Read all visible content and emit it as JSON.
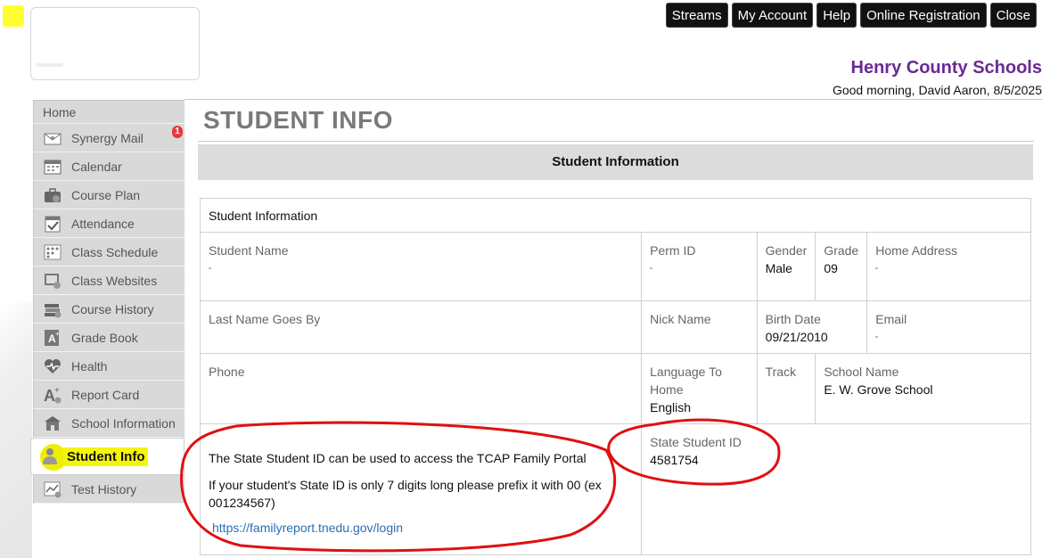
{
  "header": {
    "buttons": [
      "Streams",
      "My Account",
      "Help",
      "Online Registration",
      "Close"
    ],
    "district": "Henry County Schools",
    "greeting": "Good morning, David Aaron, 8/5/2025"
  },
  "sidebar": {
    "items": [
      {
        "label": "Home",
        "icon": "home"
      },
      {
        "label": "Synergy Mail",
        "icon": "mail-icon",
        "badge": "1"
      },
      {
        "label": "Calendar",
        "icon": "calendar-icon"
      },
      {
        "label": "Course Plan",
        "icon": "briefcase-icon"
      },
      {
        "label": "Attendance",
        "icon": "attendance-icon"
      },
      {
        "label": "Class Schedule",
        "icon": "schedule-icon"
      },
      {
        "label": "Class Websites",
        "icon": "websites-icon"
      },
      {
        "label": "Course History",
        "icon": "books-icon"
      },
      {
        "label": "Grade Book",
        "icon": "gradebook-icon"
      },
      {
        "label": "Health",
        "icon": "heart-icon"
      },
      {
        "label": "Report Card",
        "icon": "report-card-icon"
      },
      {
        "label": "School Information",
        "icon": "school-icon"
      },
      {
        "label": "Student Info",
        "icon": "student-icon"
      },
      {
        "label": "Test History",
        "icon": "test-history-icon"
      }
    ]
  },
  "main": {
    "title": "STUDENT INFO",
    "section_header": "Student Information",
    "table_caption": "Student Information",
    "fields": {
      "student_name": {
        "label": "Student Name",
        "value": ""
      },
      "perm_id": {
        "label": "Perm ID",
        "value": ""
      },
      "gender": {
        "label": "Gender",
        "value": "Male"
      },
      "grade": {
        "label": "Grade",
        "value": "09"
      },
      "home_address": {
        "label": "Home Address",
        "value": ""
      },
      "last_name_goes_by": {
        "label": "Last Name Goes By",
        "value": ""
      },
      "nick_name": {
        "label": "Nick Name",
        "value": ""
      },
      "birth_date": {
        "label": "Birth Date",
        "value": "09/21/2010"
      },
      "email": {
        "label": "Email",
        "value": ""
      },
      "phone": {
        "label": "Phone",
        "value": ""
      },
      "language": {
        "label": "Language To Home",
        "value": "English"
      },
      "track": {
        "label": "Track",
        "value": ""
      },
      "school_name": {
        "label": "School Name",
        "value": "E. W. Grove School"
      },
      "state_student_id": {
        "label": "State Student ID",
        "value": "4581754"
      }
    },
    "tcap": {
      "line1": "The State Student ID can be used to access the TCAP Family Portal",
      "line2": "If your student's State ID is only 7 digits long please prefix it with 00 (ex 001234567)",
      "link": "https://familyreport.tnedu.gov/login"
    }
  }
}
